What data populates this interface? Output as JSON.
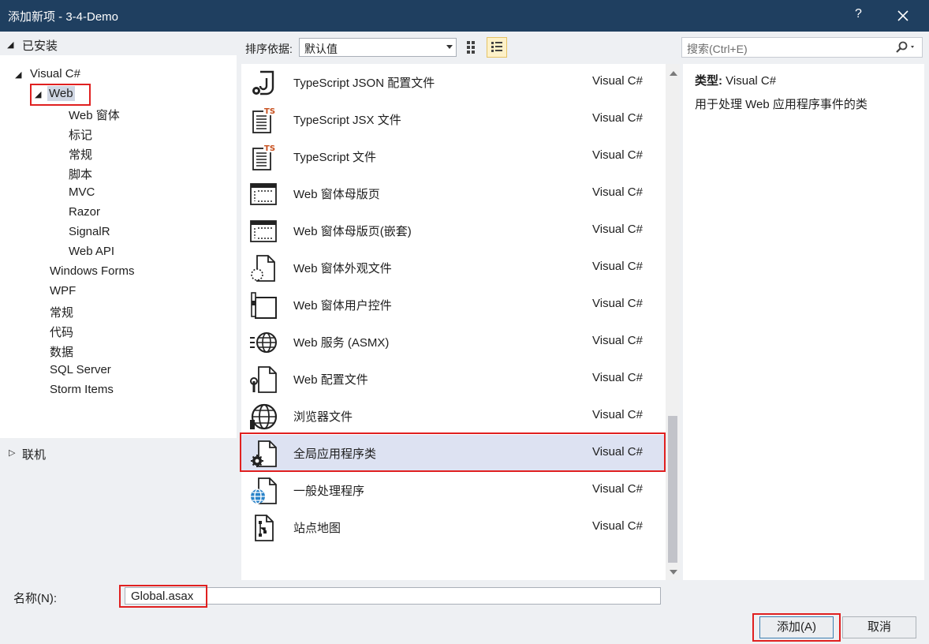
{
  "window": {
    "title": "添加新项 - 3-4-Demo",
    "help_label": "?"
  },
  "tree": {
    "installed_label": "已安装",
    "root_label": "Visual C#",
    "selected_label": "Web",
    "web_children": [
      "Web 窗体",
      "标记",
      "常规",
      "脚本",
      "MVC",
      "Razor",
      "SignalR",
      "Web API"
    ],
    "siblings": [
      "Windows Forms",
      "WPF",
      "常规",
      "代码",
      "数据",
      "SQL Server",
      "Storm Items"
    ],
    "online_label": "联机"
  },
  "toolbar": {
    "sort_label": "排序依据:",
    "sort_value": "默认值",
    "search_placeholder": "搜索(Ctrl+E)"
  },
  "items": [
    {
      "name": "TypeScript JSON 配置文件",
      "lang": "Visual C#",
      "icon": "json-config-icon"
    },
    {
      "name": "TypeScript JSX 文件",
      "lang": "Visual C#",
      "icon": "typescript-file-icon"
    },
    {
      "name": "TypeScript 文件",
      "lang": "Visual C#",
      "icon": "typescript-file-icon"
    },
    {
      "name": "Web 窗体母版页",
      "lang": "Visual C#",
      "icon": "master-page-icon"
    },
    {
      "name": "Web 窗体母版页(嵌套)",
      "lang": "Visual C#",
      "icon": "master-page-icon"
    },
    {
      "name": "Web 窗体外观文件",
      "lang": "Visual C#",
      "icon": "skin-file-icon"
    },
    {
      "name": "Web 窗体用户控件",
      "lang": "Visual C#",
      "icon": "user-control-icon"
    },
    {
      "name": "Web 服务 (ASMX)",
      "lang": "Visual C#",
      "icon": "web-service-icon"
    },
    {
      "name": "Web 配置文件",
      "lang": "Visual C#",
      "icon": "web-config-icon"
    },
    {
      "name": "浏览器文件",
      "lang": "Visual C#",
      "icon": "browser-file-icon"
    },
    {
      "name": "全局应用程序类",
      "lang": "Visual C#",
      "icon": "global-app-class-icon",
      "selected": true
    },
    {
      "name": "一般处理程序",
      "lang": "Visual C#",
      "icon": "generic-handler-icon"
    },
    {
      "name": "站点地图",
      "lang": "Visual C#",
      "icon": "sitemap-icon"
    }
  ],
  "info": {
    "type_label": "类型:",
    "type_value": "Visual C#",
    "description": "用于处理 Web 应用程序事件的类"
  },
  "footer": {
    "name_label": "名称(N):",
    "name_value": "Global.asax",
    "add_label": "添加(A)",
    "cancel_label": "取消"
  },
  "colors": {
    "titlebar": "#1f3f60",
    "selection": "#dde2f2",
    "highlight_box": "#e02020"
  }
}
